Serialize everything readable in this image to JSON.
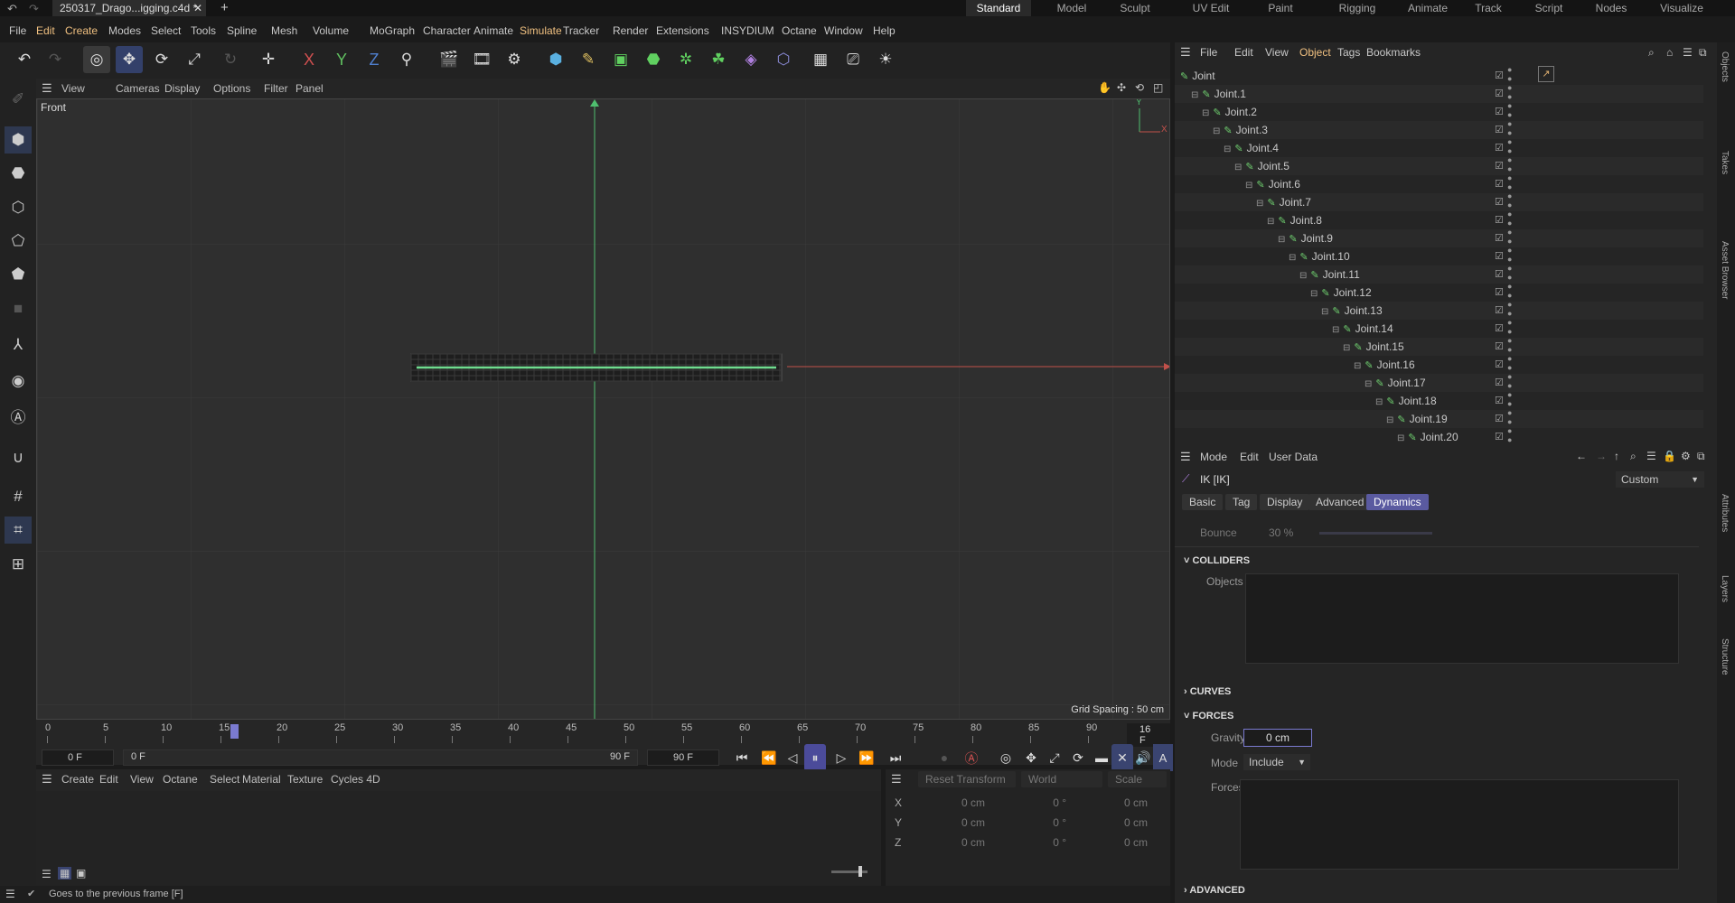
{
  "titlebar": {
    "file_tab": "250317_Drago...igging.c4d *",
    "close": "✕",
    "add": "+",
    "layouts": [
      "Standard",
      "Model",
      "Sculpt",
      "UV Edit",
      "Paint",
      "Rigging",
      "Animate",
      "Track",
      "Script",
      "Nodes",
      "Visualize"
    ],
    "active_layout": "Standard"
  },
  "menu": [
    "File",
    "Edit",
    "Create",
    "Modes",
    "Select",
    "Tools",
    "Spline",
    "Mesh",
    "Volume",
    "MoGraph",
    "Character",
    "Animate",
    "Simulate",
    "Tracker",
    "Render",
    "Extensions",
    "INSYDIUM",
    "Octane",
    "Window",
    "Help"
  ],
  "toolbar_axes": [
    "X",
    "Y",
    "Z"
  ],
  "viewport": {
    "menu": [
      "View",
      "Cameras",
      "Display",
      "Options",
      "Filter",
      "Panel"
    ],
    "name": "Front",
    "grid_spacing": "Grid Spacing : 50 cm",
    "axis_y": "Y",
    "axis_x": "X"
  },
  "timeline": {
    "ticks": [
      "0",
      "5",
      "10",
      "15",
      "20",
      "25",
      "30",
      "35",
      "40",
      "45",
      "50",
      "55",
      "60",
      "65",
      "70",
      "75",
      "80",
      "85",
      "90"
    ],
    "current_frame": "16 F",
    "start_field": "0 F",
    "start_inner": "0 F",
    "end_inner": "90 F",
    "end_field": "90 F"
  },
  "material": {
    "menu": [
      "Create",
      "Edit",
      "View",
      "Octane",
      "Select",
      "Material",
      "Texture",
      "Cycles 4D"
    ]
  },
  "coords": {
    "reset": "Reset Transform",
    "space": "World",
    "mode": "Scale",
    "rows": [
      {
        "axis": "X",
        "a": "0 cm",
        "b": "0 °",
        "c": "0 cm"
      },
      {
        "axis": "Y",
        "a": "0 cm",
        "b": "0 °",
        "c": "0 cm"
      },
      {
        "axis": "Z",
        "a": "0 cm",
        "b": "0 °",
        "c": "0 cm"
      }
    ]
  },
  "status": "Goes to the previous frame [F]",
  "objects": {
    "menu": [
      "File",
      "Edit",
      "View",
      "Object",
      "Tags",
      "Bookmarks"
    ],
    "active_menu": "Object",
    "items": [
      "Joint",
      "Joint.1",
      "Joint.2",
      "Joint.3",
      "Joint.4",
      "Joint.5",
      "Joint.6",
      "Joint.7",
      "Joint.8",
      "Joint.9",
      "Joint.10",
      "Joint.11",
      "Joint.12",
      "Joint.13",
      "Joint.14",
      "Joint.15",
      "Joint.16",
      "Joint.17",
      "Joint.18",
      "Joint.19",
      "Joint.20"
    ]
  },
  "attributes": {
    "menu": [
      "Mode",
      "Edit",
      "User Data"
    ],
    "title": "IK [IK]",
    "preset": "Custom",
    "tabs": [
      "Basic",
      "Tag",
      "Display",
      "Advanced",
      "Dynamics"
    ],
    "active_tab": "Dynamics",
    "bounce_label": "Bounce",
    "bounce_value": "30 %",
    "colliders": "COLLIDERS",
    "objects_label": "Objects",
    "curves": "CURVES",
    "forces": "FORCES",
    "gravity_label": "Gravity",
    "gravity_value": "0 cm",
    "mode_label": "Mode",
    "mode_value": "Include",
    "forces_label": "Forces",
    "advanced": "ADVANCED"
  },
  "side_tabs": [
    "Objects",
    "Takes",
    "Asset Browser",
    "Attributes",
    "Layers",
    "Structure"
  ],
  "colors": {
    "accent": "#5a5aa0",
    "y_axis": "#4fbf6f",
    "x_axis": "#c0504a",
    "joint": "#6fcf6f"
  }
}
